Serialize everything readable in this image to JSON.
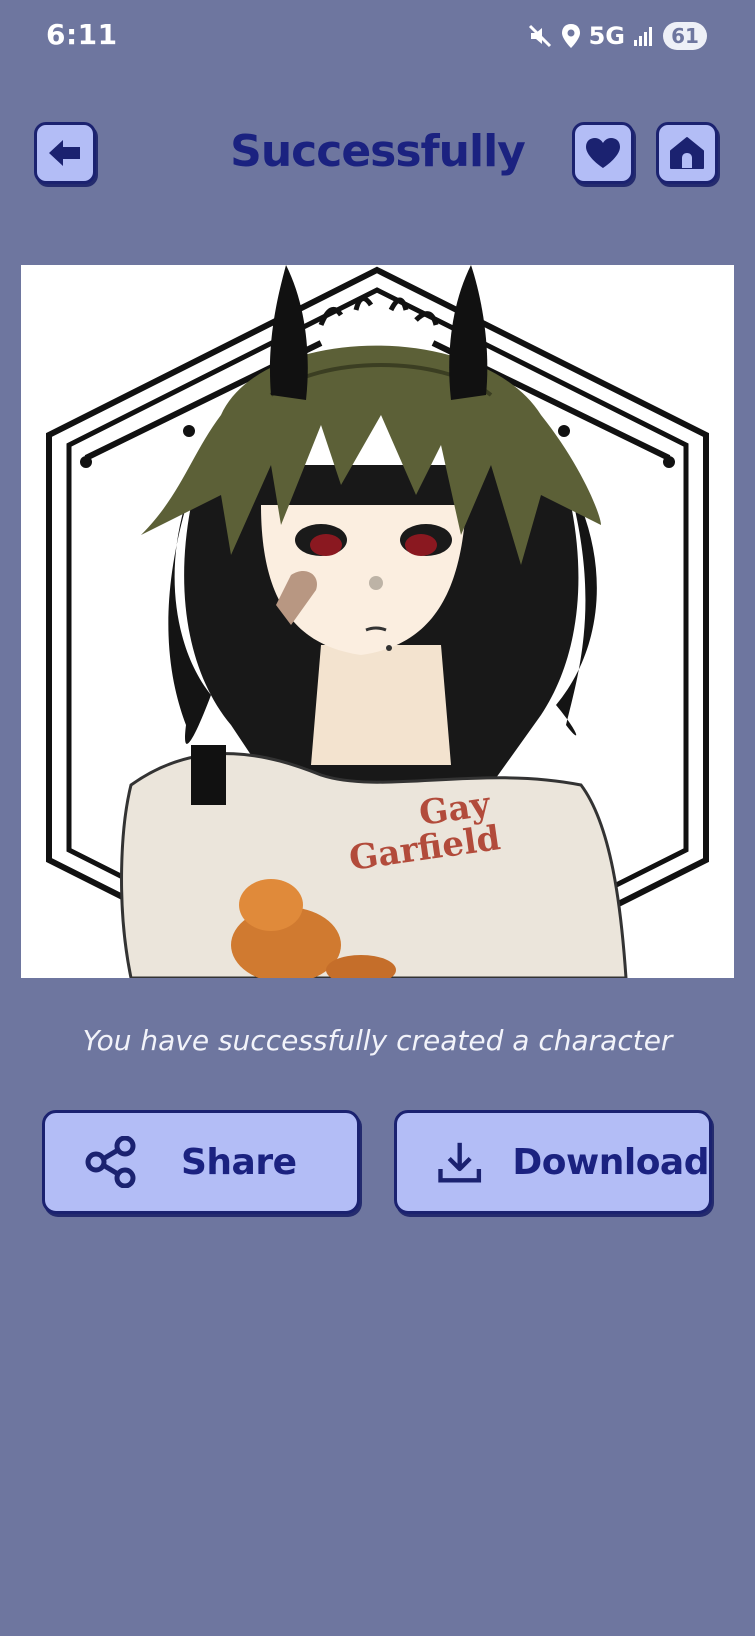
{
  "status_bar": {
    "time": "6:11",
    "network": "5G",
    "battery": "61",
    "icons": [
      "mute-icon",
      "location-icon",
      "signal-icon"
    ]
  },
  "header": {
    "title": "Successfully",
    "back_icon": "arrow-left-icon",
    "favorite_icon": "heart-icon",
    "home_icon": "home-icon"
  },
  "result": {
    "shirt_text_line1": "Gay",
    "shirt_text_line2": "Garfield",
    "message": "You have successfully created a character"
  },
  "actions": {
    "share_label": "Share",
    "share_icon": "share-icon",
    "download_label": "Download",
    "download_icon": "download-icon"
  },
  "colors": {
    "background": "#6e769f",
    "button_fill": "#b3bdf6",
    "button_border": "#1b2270",
    "title": "#1b2280"
  }
}
